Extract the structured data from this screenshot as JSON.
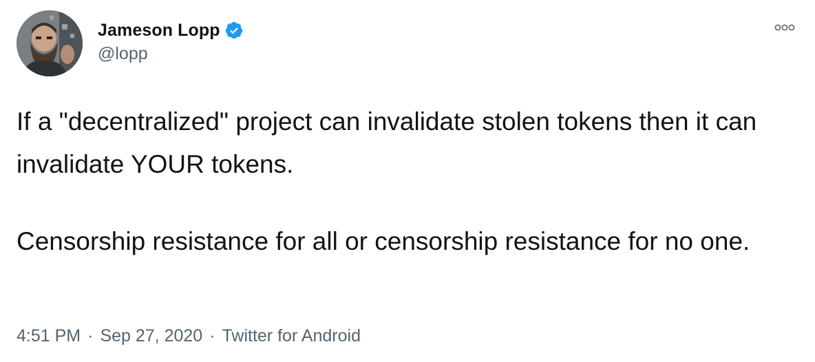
{
  "author": {
    "display_name": "Jameson Lopp",
    "handle": "@lopp",
    "verified_icon": "verified-badge-icon"
  },
  "colors": {
    "text": "#0f1419",
    "secondary": "#536471",
    "verified": "#1d9bf0"
  },
  "tweet": {
    "paragraph_1": "If a \"decentralized\" project can invalidate stolen tokens then it can invalidate YOUR tokens.",
    "paragraph_2": "Censorship resistance for all or censorship resistance for no one."
  },
  "meta": {
    "time": "4:51 PM",
    "separator": "·",
    "date": "Sep 27, 2020",
    "source": "Twitter for Android"
  }
}
